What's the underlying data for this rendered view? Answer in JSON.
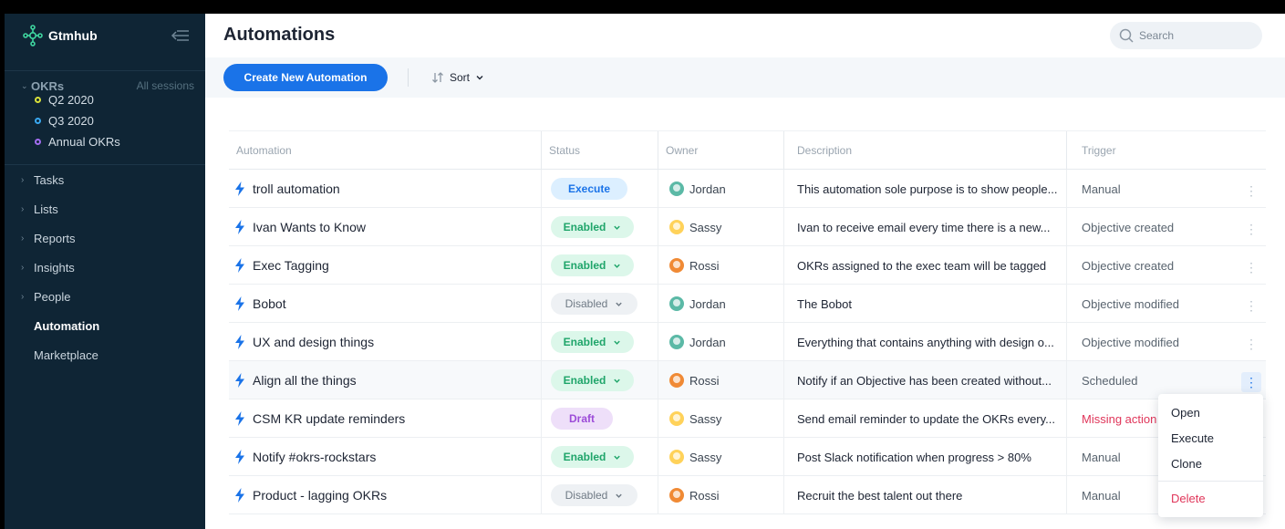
{
  "app": {
    "brand": "Gtmhub"
  },
  "sidebar": {
    "okrs": {
      "title": "OKRs",
      "sessions_link": "All sessions",
      "sessions": [
        {
          "label": "Q2 2020",
          "color": "#d8e03a"
        },
        {
          "label": "Q3 2020",
          "color": "#39a8f0"
        },
        {
          "label": "Annual OKRs",
          "color": "#a26df0"
        }
      ]
    },
    "nav": [
      {
        "label": "Tasks"
      },
      {
        "label": "Lists"
      },
      {
        "label": "Reports"
      },
      {
        "label": "Insights"
      },
      {
        "label": "People"
      },
      {
        "label": "Automation"
      },
      {
        "label": "Marketplace"
      }
    ],
    "active": "Automation"
  },
  "page": {
    "title": "Automations",
    "search_placeholder": "Search",
    "create_label": "Create New Automation",
    "sort_label": "Sort"
  },
  "table": {
    "columns": [
      "Automation",
      "Status",
      "Owner",
      "Description",
      "Trigger"
    ],
    "rows": [
      {
        "name": "troll automation",
        "status": "Execute",
        "owner": "Jordan",
        "description": "This automation sole purpose is to show people...",
        "trigger": "Manual"
      },
      {
        "name": "Ivan Wants to Know",
        "status": "Enabled",
        "owner": "Sassy",
        "description": "Ivan to receive email every time there is a new...",
        "trigger": "Objective created"
      },
      {
        "name": "Exec Tagging",
        "status": "Enabled",
        "owner": "Rossi",
        "description": "OKRs assigned to the exec team will be tagged",
        "trigger": "Objective created"
      },
      {
        "name": "Bobot",
        "status": "Disabled",
        "owner": "Jordan",
        "description": "The Bobot",
        "trigger": "Objective modified"
      },
      {
        "name": "UX and design things",
        "status": "Enabled",
        "owner": "Jordan",
        "description": "Everything that contains anything with design o...",
        "trigger": "Objective modified"
      },
      {
        "name": "Align all the things",
        "status": "Enabled",
        "owner": "Rossi",
        "description": "Notify if an Objective has been created without...",
        "trigger": "Scheduled"
      },
      {
        "name": "CSM KR update reminders",
        "status": "Draft",
        "owner": "Sassy",
        "description": "Send email reminder to update the OKRs every...",
        "trigger": "Missing action"
      },
      {
        "name": "Notify #okrs-rockstars",
        "status": "Enabled",
        "owner": "Sassy",
        "description": "Post Slack notification when progress > 80%",
        "trigger": "Manual"
      },
      {
        "name": "Product - lagging OKRs",
        "status": "Disabled",
        "owner": "Rossi",
        "description": "Recruit the best talent out there",
        "trigger": "Manual"
      }
    ]
  },
  "context_menu": {
    "items": [
      "Open",
      "Execute",
      "Clone"
    ],
    "danger_item": "Delete"
  }
}
